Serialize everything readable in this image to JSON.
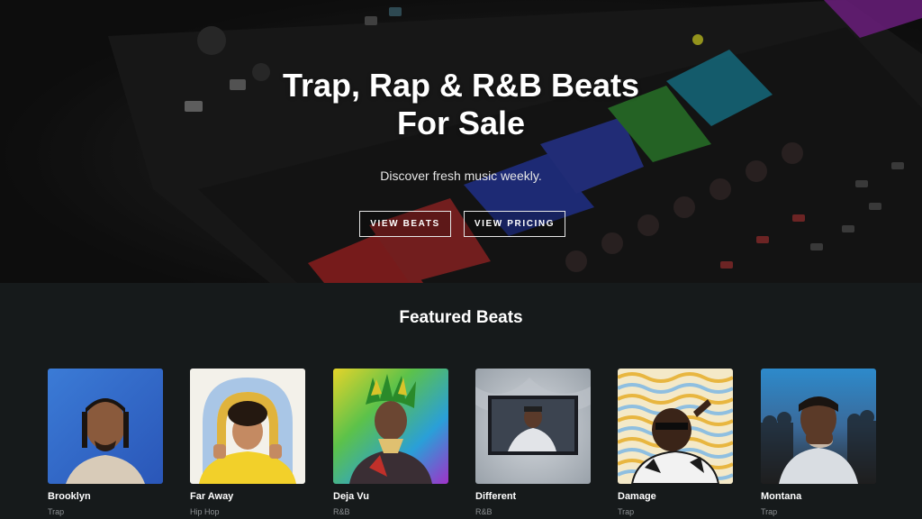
{
  "hero": {
    "title_line1": "Trap, Rap & R&B Beats",
    "title_line2": "For Sale",
    "subtitle": "Discover fresh music weekly.",
    "buttons": [
      {
        "label": "VIEW BEATS"
      },
      {
        "label": "VIEW PRICING"
      }
    ],
    "pad_colors": [
      "#c92c2c",
      "#2f45c4",
      "#3aa63a",
      "#1f9ab5",
      "#9b2bb5"
    ]
  },
  "featured": {
    "heading": "Featured Beats",
    "beats": [
      {
        "title": "Brooklyn",
        "genre": "Trap",
        "artwork": "portrait-blue-background"
      },
      {
        "title": "Far Away",
        "genre": "Hip Hop",
        "artwork": "portrait-yellow-hoodie"
      },
      {
        "title": "Deja Vu",
        "genre": "R&B",
        "artwork": "portrait-gradient-colorful"
      },
      {
        "title": "Different",
        "genre": "R&B",
        "artwork": "photo-in-frame-grey"
      },
      {
        "title": "Damage",
        "genre": "Trap",
        "artwork": "portrait-wavy-lines"
      },
      {
        "title": "Montana",
        "genre": "Trap",
        "artwork": "portrait-stadium-crowd"
      }
    ]
  }
}
